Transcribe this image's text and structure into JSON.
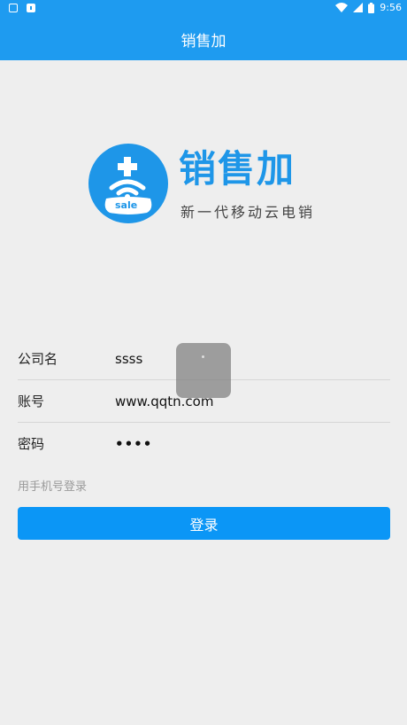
{
  "status_bar": {
    "time": "9:56",
    "icons": [
      "notification-icon",
      "app-icon",
      "wifi-icon",
      "signal-icon",
      "battery-icon"
    ]
  },
  "app_bar": {
    "title": "销售加"
  },
  "logo": {
    "brand_name": "销售加",
    "slogan": "新一代移动云电销",
    "badge_text": "sale",
    "brand_color": "#1E96E8"
  },
  "form": {
    "company": {
      "label": "公司名",
      "value": "ssss"
    },
    "account": {
      "label": "账号",
      "value": "www.qqtn.com"
    },
    "password": {
      "label": "密码",
      "value": "••••"
    }
  },
  "phone_login_link": "用手机号登录",
  "login_button": "登录",
  "colors": {
    "primary": "#1E9BF0",
    "button": "#0B96F6",
    "background": "#EEEEEE"
  }
}
